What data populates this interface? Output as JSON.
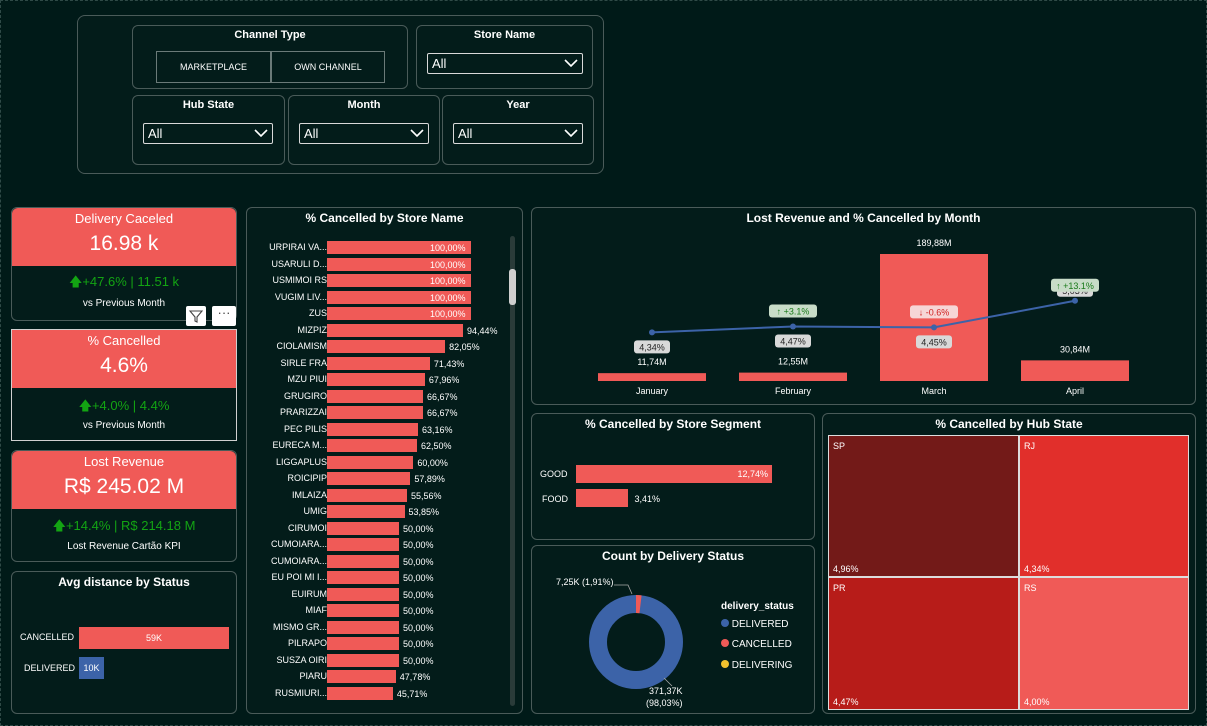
{
  "filters": {
    "channel_type": {
      "label": "Channel Type",
      "options": [
        "MARKETPLACE",
        "OWN CHANNEL"
      ]
    },
    "store_name": {
      "label": "Store Name",
      "value": "All"
    },
    "hub_state": {
      "label": "Hub State",
      "value": "All"
    },
    "month": {
      "label": "Month",
      "value": "All"
    },
    "year": {
      "label": "Year",
      "value": "All"
    }
  },
  "kpis": [
    {
      "title": "Delivery Caceled",
      "value": "16.98 k",
      "delta": "+47.6% |  11.51 k",
      "sub": "vs Previous Month"
    },
    {
      "title": "% Cancelled",
      "value": "4.6%",
      "delta": "+4.0% | 4.4%",
      "sub": "vs Previous Month"
    },
    {
      "title": "Lost Revenue",
      "value": "R$ 245.02 M",
      "delta": "+14.4% | R$ 214.18 M",
      "sub": "Lost Revenue Cartão KPI"
    }
  ],
  "avg_distance": {
    "title": "Avg distance by Status",
    "chart_data": {
      "type": "bar",
      "categories": [
        "CANCELLED",
        "DELIVERED"
      ],
      "labels": [
        "59K",
        "10K"
      ],
      "values": [
        59,
        10
      ],
      "colors": [
        "#f05a57",
        "#3c63a8"
      ]
    }
  },
  "store_chart": {
    "title": "% Cancelled by Store Name",
    "chart_data": {
      "type": "bar",
      "categories": [
        "URPIRAI VA...",
        "USARULI D...",
        "USMIMOI RS",
        "VUGIM LIV...",
        "ZUS",
        "MIZPIZ",
        "CIOLAMISM",
        "SIRLE FRA",
        "MZU PIUI",
        "GRUGIRO",
        "PRARIZZAI",
        "PEC PILIS",
        "EURECA M...",
        "LIGGAPLUS",
        "ROICIPIP",
        "IMLAIZA",
        "UMIG",
        "CIRUMOI",
        "CUMOIARA...",
        "CUMOIARA...",
        "EU POI MI I...",
        "EUIRUM",
        "MIAF",
        "MISMO GR...",
        "PILRAPO",
        "SUSZA OIRI",
        "PIARU",
        "RUSMIURI..."
      ],
      "labels": [
        "100,00%",
        "100,00%",
        "100,00%",
        "100,00%",
        "100,00%",
        "94,44%",
        "82,05%",
        "71,43%",
        "67,96%",
        "66,67%",
        "66,67%",
        "63,16%",
        "62,50%",
        "60,00%",
        "57,89%",
        "55,56%",
        "53,85%",
        "50,00%",
        "50,00%",
        "50,00%",
        "50,00%",
        "50,00%",
        "50,00%",
        "50,00%",
        "50,00%",
        "50,00%",
        "47,78%",
        "45,71%"
      ],
      "values": [
        100,
        100,
        100,
        100,
        100,
        94.44,
        82.05,
        71.43,
        67.96,
        66.67,
        66.67,
        63.16,
        62.5,
        60,
        57.89,
        55.56,
        53.85,
        50,
        50,
        50,
        50,
        50,
        50,
        50,
        50,
        50,
        47.78,
        45.71
      ]
    }
  },
  "month_chart": {
    "title": "Lost Revenue and % Cancelled by Month",
    "chart_data": {
      "type": "bar",
      "categories": [
        "January",
        "February",
        "March",
        "April"
      ],
      "revenue_labels": [
        "11,74M",
        "12,55M",
        "189,88M",
        "30,84M"
      ],
      "revenue": [
        11.74,
        12.55,
        189.88,
        30.84
      ],
      "pct_labels": [
        "4,34%",
        "4,47%",
        "4,45%",
        "5,03%"
      ],
      "pct": [
        4.34,
        4.47,
        4.45,
        5.03
      ],
      "change_labels": [
        "",
        "+3.1%",
        "-0.6%",
        "+13.1%"
      ]
    }
  },
  "segment_chart": {
    "title": "% Cancelled by Store Segment",
    "chart_data": {
      "type": "bar",
      "categories": [
        "GOOD",
        "FOOD"
      ],
      "labels": [
        "12,74%",
        "3,41%"
      ],
      "values": [
        12.74,
        3.41
      ]
    }
  },
  "delivery_status": {
    "title": "Count by Delivery Status",
    "legend_title": "delivery_status",
    "chart_data": {
      "type": "pie",
      "categories": [
        "DELIVERED",
        "CANCELLED",
        "DELIVERING"
      ],
      "values": [
        371.37,
        7.25,
        0
      ],
      "colors": [
        "#3c63a8",
        "#f05a57",
        "#f2c12e"
      ],
      "label_cancelled": "7,25K (1,91%)",
      "label_delivered_1": "371,37K",
      "label_delivered_2": "(98,03%)"
    }
  },
  "hub_state": {
    "title": "% Cancelled by Hub State",
    "chart_data": {
      "type": "treemap",
      "categories": [
        "SP",
        "RJ",
        "PR",
        "RS"
      ],
      "labels": [
        "4,96%",
        "4,34%",
        "4,47%",
        "4,00%"
      ],
      "values": [
        4.96,
        4.34,
        4.47,
        4.0
      ]
    }
  }
}
